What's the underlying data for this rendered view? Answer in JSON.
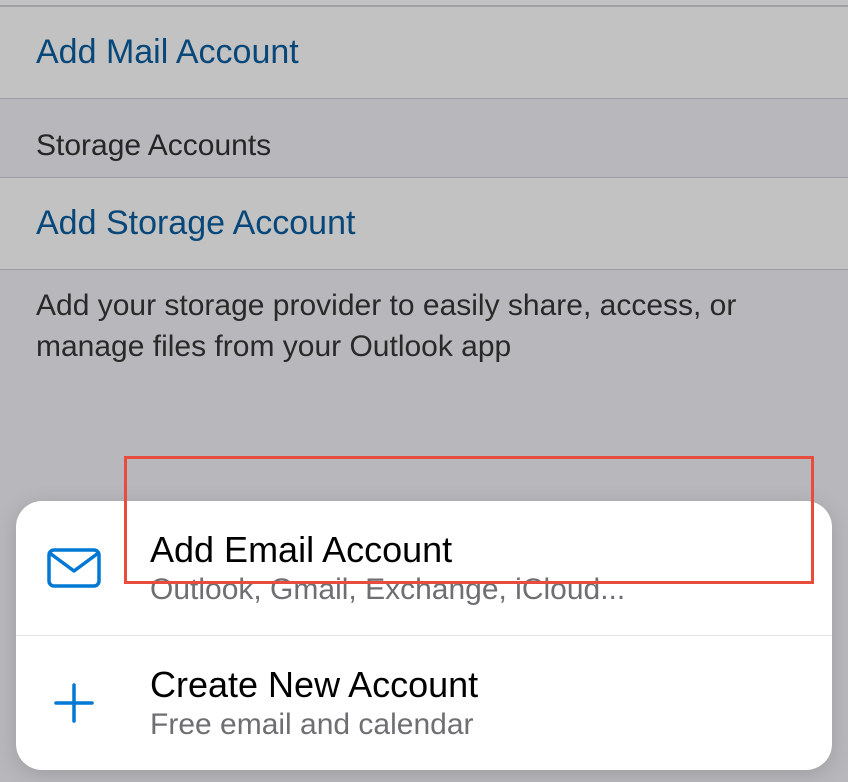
{
  "mail_section": {
    "add_mail_label": "Add Mail Account"
  },
  "storage_section": {
    "header": "Storage Accounts",
    "add_storage_label": "Add Storage Account",
    "footer": "Add your storage provider to easily share, access, or manage files from your Outlook app"
  },
  "action_sheet": {
    "add_email": {
      "title": "Add Email Account",
      "subtitle": "Outlook, Gmail, Exchange, iCloud..."
    },
    "create_new": {
      "title": "Create New Account",
      "subtitle": "Free email and calendar"
    }
  },
  "colors": {
    "accent": "#0078d4",
    "highlight": "#e74c3c"
  }
}
